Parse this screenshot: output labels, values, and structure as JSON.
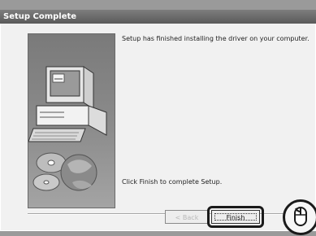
{
  "window": {
    "title": "Setup Complete"
  },
  "content": {
    "message_top": "Setup has finished installing the driver on your computer.",
    "message_bottom": "Click Finish to complete Setup."
  },
  "buttons": {
    "back_label": "< Back",
    "finish_label": "Finish"
  },
  "icons": {
    "illustration": "computer-illustration-icon",
    "mouse": "mouse-icon"
  },
  "colors": {
    "titlebar": "#6a6a6a",
    "panel": "#8c8c8c"
  }
}
